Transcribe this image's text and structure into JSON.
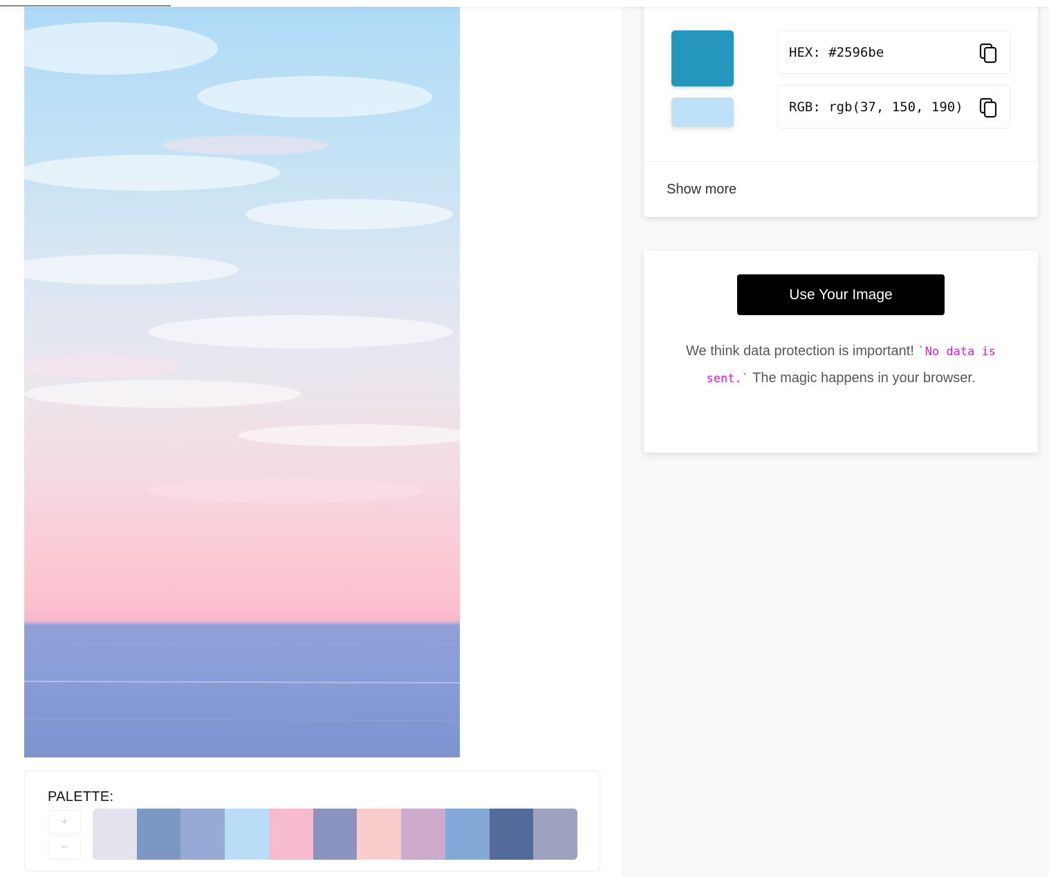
{
  "palette": {
    "title": "PALETTE:",
    "add_label": "+",
    "remove_label": "−",
    "swatches": [
      "#e3e2ed",
      "#7d97c5",
      "#97a9d5",
      "#b9ddf4",
      "#f6bccd",
      "#8b93c1",
      "#f9cdcb",
      "#cfabcb",
      "#82a9d7",
      "#536b9b",
      "#9da2bf"
    ]
  },
  "color": {
    "main_hex": "#2596be",
    "secondary_hex": "#bde1f7",
    "hex_text": "HEX: #2596be",
    "rgb_text": "RGB: rgb(37, 150, 190)",
    "show_more": "Show more"
  },
  "upload": {
    "button": "Use Your Image",
    "note_before": "We think data protection is important! ",
    "note_code": "`No data is sent.`",
    "note_after": " The magic happens in your browser."
  }
}
